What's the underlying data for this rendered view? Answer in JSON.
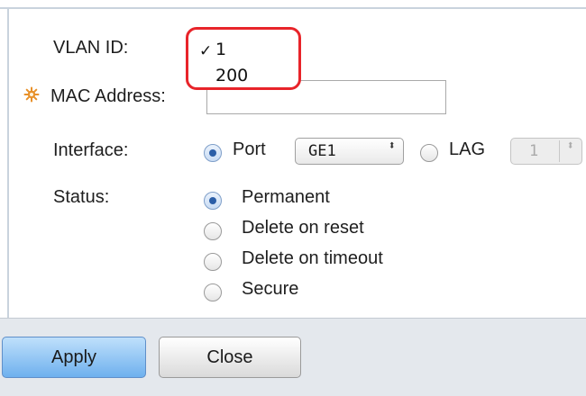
{
  "form": {
    "vlan_id_label": "VLAN ID:",
    "mac_address_label": "MAC Address:",
    "mac_address_value": "",
    "interface_label": "Interface:",
    "status_label": "Status:"
  },
  "vlan_dropdown": {
    "options": [
      "1",
      "200"
    ],
    "selected": "1",
    "check_glyph": "✓"
  },
  "interface": {
    "port_label": "Port",
    "port_value": "GE1",
    "port_selected": true,
    "lag_label": "LAG",
    "lag_value": "1",
    "lag_selected": false
  },
  "status": {
    "options": [
      {
        "label": "Permanent",
        "selected": true
      },
      {
        "label": "Delete on reset",
        "selected": false
      },
      {
        "label": "Delete on timeout",
        "selected": false
      },
      {
        "label": "Secure",
        "selected": false
      }
    ]
  },
  "buttons": {
    "apply_label": "Apply",
    "close_label": "Close"
  },
  "colors": {
    "required_icon": "#e8912a",
    "highlight_border": "#e8242a",
    "apply_button": "#8cc4f3"
  }
}
